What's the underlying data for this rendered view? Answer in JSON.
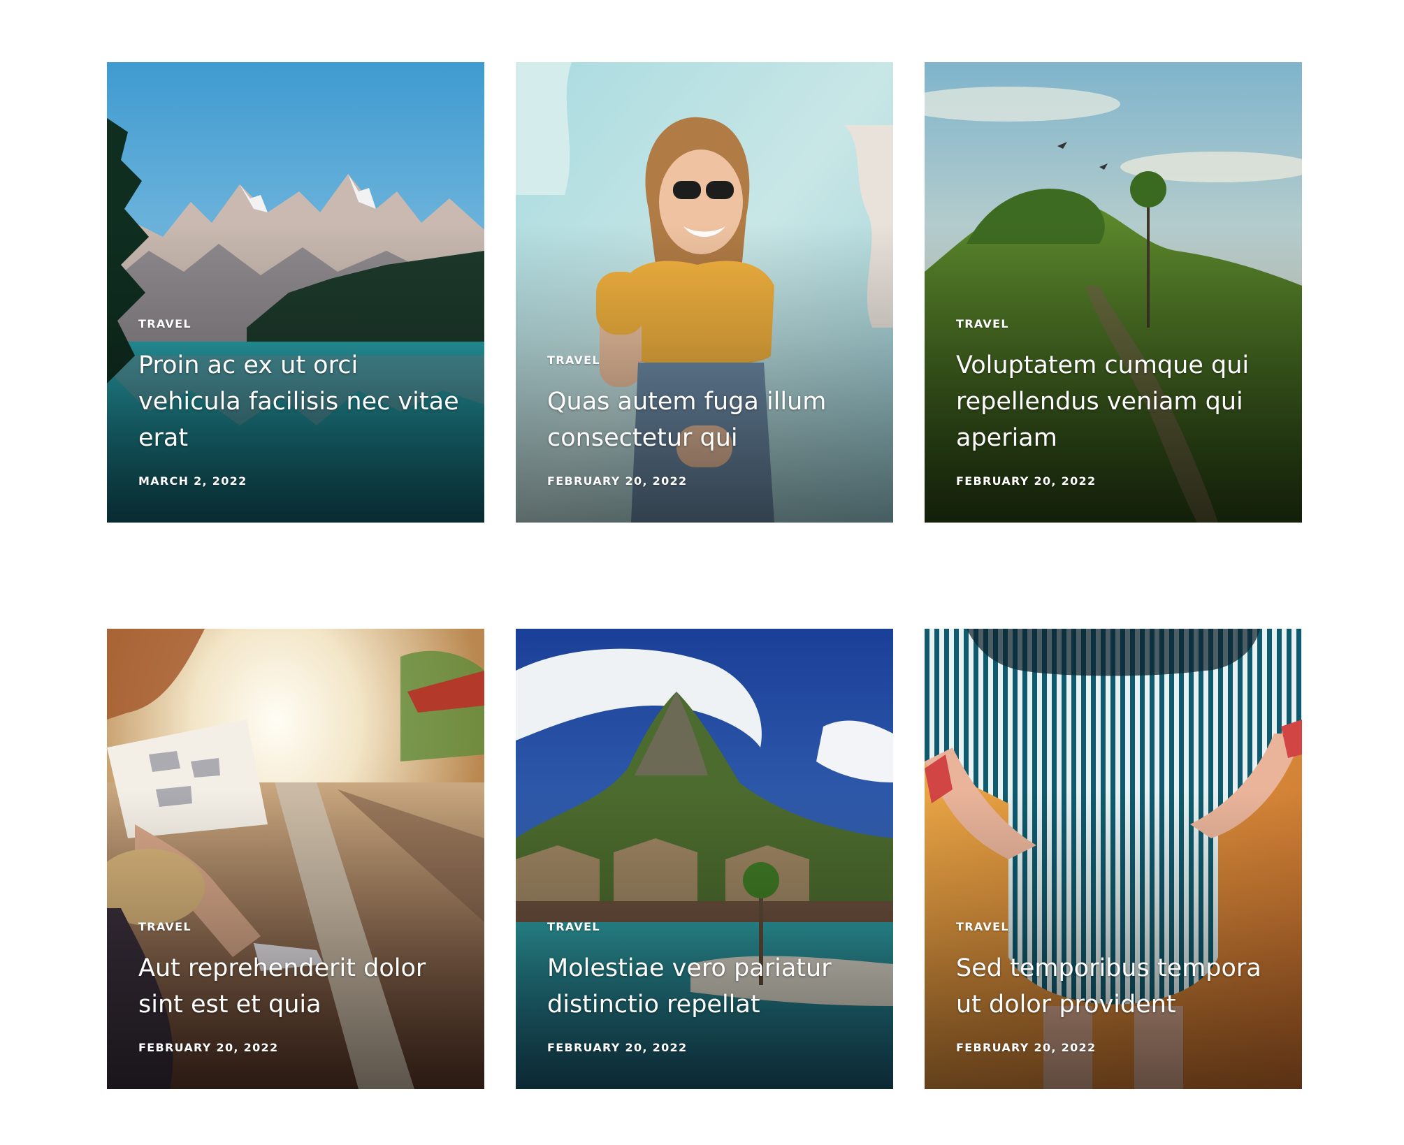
{
  "posts": [
    {
      "category": "Travel",
      "title": "Proin ac ex ut orci vehicula facilisis nec vitae erat",
      "date": "March 2, 2022",
      "image_icon": "mountain-lake-photo"
    },
    {
      "category": "Travel",
      "title": "Quas autem fuga illum consectetur qui",
      "date": "February 20, 2022",
      "image_icon": "woman-sunglasses-photo"
    },
    {
      "category": "Travel",
      "title": "Voluptatem cumque qui repellendus veniam qui aperiam",
      "date": "February 20, 2022",
      "image_icon": "green-hills-photo"
    },
    {
      "category": "Travel",
      "title": "Aut reprehenderit dolor sint est et quia",
      "date": "February 20, 2022",
      "image_icon": "railway-map-photo"
    },
    {
      "category": "Travel",
      "title": "Molestiae vero pariatur distinctio repellat",
      "date": "February 20, 2022",
      "image_icon": "tropical-island-photo"
    },
    {
      "category": "Travel",
      "title": "Sed temporibus tempora ut dolor provident",
      "date": "February 20, 2022",
      "image_icon": "striped-dress-photo"
    }
  ]
}
